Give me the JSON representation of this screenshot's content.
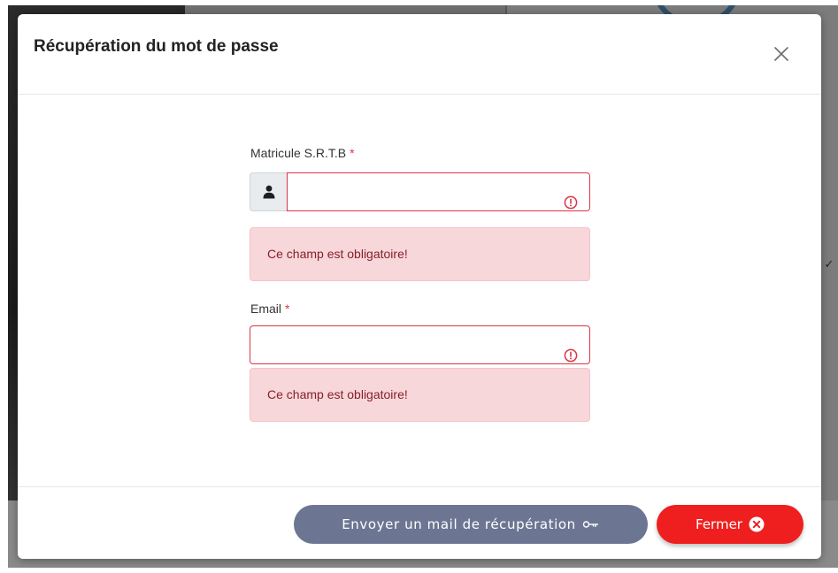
{
  "modal": {
    "title": "Récupération du mot de passe"
  },
  "form": {
    "matricule": {
      "label": "Matricule S.R.T.B",
      "required_mark": "*",
      "value": "",
      "error": "Ce champ est obligatoire!"
    },
    "email": {
      "label": "Email",
      "required_mark": "*",
      "value": "",
      "error": "Ce champ est obligatoire!"
    }
  },
  "footer": {
    "send_label": "Envoyer un mail de récupération",
    "close_label": "Fermer"
  },
  "icons": {
    "close": "close-icon",
    "user": "user-icon",
    "invalid": "exclamation-circle-icon",
    "key": "key-icon",
    "x_circle": "x-circle-icon"
  },
  "colors": {
    "send_button": "#6c7693",
    "close_button": "#ef1f1f",
    "error_border": "#dc3545",
    "alert_background": "#f8d7da",
    "alert_text": "#842029"
  }
}
